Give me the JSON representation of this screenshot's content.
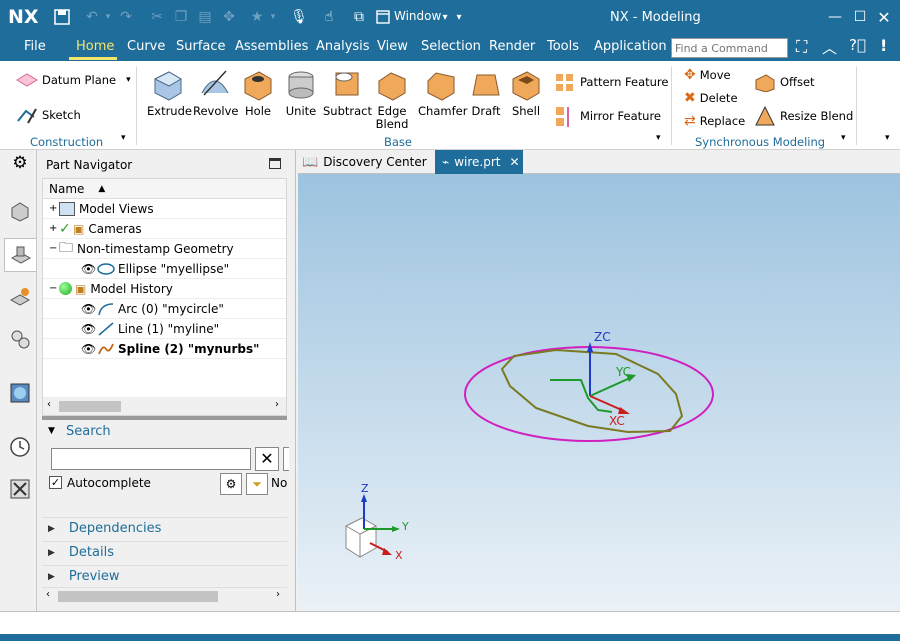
{
  "titlebar": {
    "logo": "NX",
    "window_menu": "Window",
    "title": "NX - Modeling"
  },
  "menu": {
    "file": "File",
    "tabs": [
      "Home",
      "Curve",
      "Surface",
      "Assemblies",
      "Analysis",
      "View",
      "Selection",
      "Render",
      "Tools",
      "Application"
    ],
    "active": "Home",
    "find_placeholder": "Find a Command"
  },
  "ribbon": {
    "construction": {
      "datum_plane": "Datum Plane",
      "sketch": "Sketch",
      "label": "Construction"
    },
    "base": {
      "buttons": [
        "Extrude",
        "Revolve",
        "Hole",
        "Unite",
        "Subtract",
        "Edge Blend",
        "Chamfer",
        "Draft",
        "Shell"
      ],
      "pattern": "Pattern Feature",
      "mirror": "Mirror Feature",
      "label": "Base"
    },
    "sync": {
      "move": "Move",
      "delete": "Delete",
      "replace": "Replace",
      "offset": "Offset",
      "resize_blend": "Resize Blend",
      "label": "Synchronous Modeling"
    }
  },
  "navigator": {
    "title": "Part Navigator",
    "column": "Name",
    "rows": [
      "Model Views",
      "Cameras",
      "Non-timestamp Geometry",
      "Ellipse \"myellipse\"",
      "Model History",
      "Arc (0) \"mycircle\"",
      "Line (1) \"myline\"",
      "Spline (2) \"mynurbs\""
    ],
    "search_label": "Search",
    "autocomplete": "Autocomplete",
    "no_label": "No",
    "sections": [
      "Dependencies",
      "Details",
      "Preview"
    ]
  },
  "viewport": {
    "tabs": [
      "Discovery Center",
      "wire.prt"
    ],
    "axes": {
      "zc": "ZC",
      "yc": "YC",
      "xc": "XC",
      "z": "Z",
      "y": "Y",
      "x": "X"
    }
  },
  "colors": {
    "accent": "#1e6d9a",
    "highlight": "#f5e56b"
  }
}
